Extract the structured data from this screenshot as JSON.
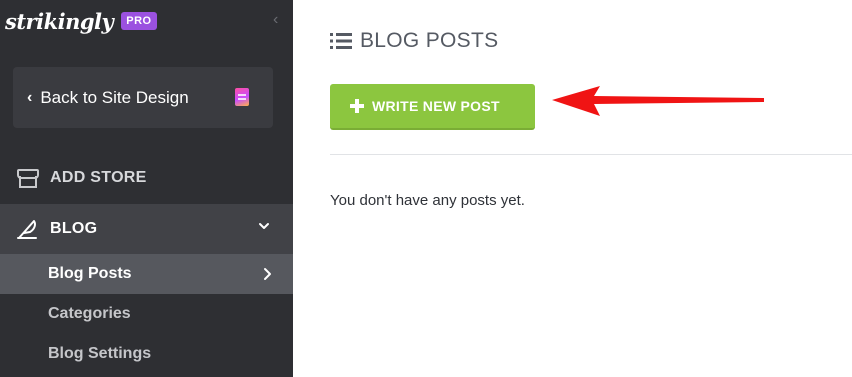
{
  "brand": {
    "logo_text": "strikingly",
    "badge": "PRO",
    "badge_color": "#9b51e0"
  },
  "sidebar": {
    "collapse_icon": "chevron-left-icon",
    "back_button": {
      "label": "Back to Site Design",
      "icon": "chevron-left-icon",
      "trailing_icon": "page-icon"
    },
    "items": [
      {
        "label": "ADD STORE",
        "icon": "store-icon"
      },
      {
        "label": "BLOG",
        "icon": "quill-icon",
        "expanded": true,
        "children": [
          {
            "label": "Blog Posts",
            "active": true
          },
          {
            "label": "Categories"
          },
          {
            "label": "Blog Settings"
          }
        ]
      }
    ]
  },
  "main": {
    "title": "BLOG POSTS",
    "title_icon": "list-icon",
    "write_button": {
      "label": "WRITE NEW POST",
      "icon": "plus-icon",
      "color": "#8cc63f"
    },
    "empty_message": "You don't have any posts yet."
  },
  "annotation": {
    "type": "arrow",
    "color": "#f01414",
    "points_to": "write-new-post-button"
  }
}
